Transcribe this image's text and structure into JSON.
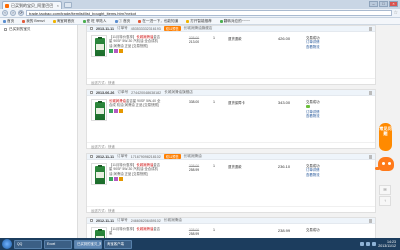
{
  "browser": {
    "tab_title": "已买到的宝贝_阿里巴巴",
    "url": "trade.taobao.com/trade/itemlist/list_bought_items.htm?nekot",
    "nav": {
      "back": "‹",
      "forward": "›",
      "reload": "⟳"
    },
    "window_controls": {
      "min": "–",
      "max": "□",
      "close": "×"
    },
    "bookmarks": [
      "首页",
      "我的 Brenzi",
      "淘宝网首页",
      "爱 旺 甲陆人",
      "ⓘ 首页",
      "在一进一下，也能知道",
      "打开智能推荐",
      "翻转对应的~~~~"
    ]
  },
  "left_nav": {
    "items": [
      "已买到的宝贝"
    ]
  },
  "orders": [
    {
      "date": "2013-11-11",
      "order_label": "订单号",
      "order_id": "453533332316193",
      "tag": "双11预售",
      "shop": "长城润滑油旗舰店",
      "title_prefix": "【11月特价惠享】",
      "title_red": "长城润滑油",
      "title_rest": "金吉星 90SF 5W-30 汽机油 全合成机油 润滑油 正品 [交易快照]",
      "old_price": "338.00",
      "price": "213.00",
      "qty": "1",
      "action": "退货退款",
      "total": "426.00",
      "status": [
        "交易成功",
        "订单详情",
        "查看物流"
      ],
      "footer": "运送方式：快递"
    },
    {
      "date": "2013-06-26",
      "order_label": "订单号",
      "order_id": "274420048638182",
      "tag": "",
      "shop": "长城润滑油旗舰店",
      "title_prefix": "",
      "title_red": "长城润滑油",
      "title_rest": "金吉星 90SF 5W-40 全合成 机油 润滑油 正品 [交易快照]",
      "old_price": "",
      "price": "338.00",
      "qty": "1",
      "action": "退货保障卡",
      "total": "343.00",
      "status": [
        "交易成功",
        "订单详情",
        "查看物流"
      ],
      "footer": "运送方式：快递"
    },
    {
      "date": "2012-11-11",
      "order_label": "订单号",
      "order_id": "171679098218102",
      "tag": "双11预售",
      "shop": "长城润滑油",
      "title_prefix": "【11月特价惠享】",
      "title_red": "长城润滑油",
      "title_rest": "金吉星 90SF 5W-30 汽机油 全合成机油 润滑油 正品 [交易快照]",
      "old_price": "338.00",
      "price": "258.99",
      "qty": "1",
      "action": "退货退款",
      "total": "236.10",
      "status": [
        "交易成功",
        "订单详情",
        "查看物流"
      ],
      "footer": "运送方式：快递"
    },
    {
      "date": "2012-11-11",
      "order_label": "订单号",
      "order_id": "246606206459102",
      "tag": "",
      "shop": "长城润滑油",
      "title_prefix": "【11月特价惠享】",
      "title_red": "长城润滑油",
      "title_rest": "金吉星",
      "old_price": "338.00",
      "price": "258.99",
      "qty": "1",
      "action": "",
      "total": "238.99",
      "status": [
        "交易成功"
      ],
      "footer": ""
    }
  ],
  "side": {
    "qa_label": "常见问题",
    "buttons": [
      "✉",
      "↑"
    ]
  },
  "taskbar": {
    "tasks": [
      "QQ",
      "Excel",
      "已买到的宝贝_阿...",
      "淘宝客户端"
    ],
    "clock_time": "14:23",
    "clock_date": "2013/11/12"
  }
}
